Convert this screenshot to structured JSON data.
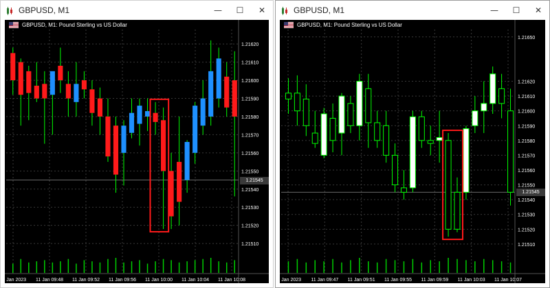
{
  "windows": [
    {
      "title": "GBPUSD, M1",
      "caption": "GBPUSD, M1:  Pound Sterling vs US Dollar",
      "current_price": "1.21545",
      "colors": {
        "bull": "#1e90ff",
        "bear": "#ff1a1a",
        "wick": "#00ff00",
        "highlight": "#ff1a1a"
      },
      "chart_data": {
        "type": "candlestick",
        "style": "colored-bodies",
        "y_axis_labels": [
          "1.21620",
          "1.21610",
          "1.21600",
          "1.21590",
          "1.21580",
          "1.21570",
          "1.21560",
          "1.21550",
          "1.21540",
          "1.21530",
          "1.21520",
          "1.21510"
        ],
        "ylim": [
          1.21504,
          1.21628
        ],
        "x_axis_labels": [
          "11 Jan 2023",
          "11 Jan 09:48",
          "11 Jan 09:52",
          "11 Jan 09:56",
          "11 Jan 10:00",
          "11 Jan 10:04",
          "11 Jan 10:08"
        ],
        "candles": [
          {
            "o": 1.21615,
            "h": 1.21618,
            "l": 1.21592,
            "c": 1.216
          },
          {
            "o": 1.2161,
            "h": 1.21612,
            "l": 1.21575,
            "c": 1.21592
          },
          {
            "o": 1.21605,
            "h": 1.21608,
            "l": 1.21578,
            "c": 1.21593
          },
          {
            "o": 1.21597,
            "h": 1.2161,
            "l": 1.21588,
            "c": 1.2159
          },
          {
            "o": 1.21598,
            "h": 1.21605,
            "l": 1.21565,
            "c": 1.2159
          },
          {
            "o": 1.21592,
            "h": 1.216,
            "l": 1.2157,
            "c": 1.21605
          },
          {
            "o": 1.21608,
            "h": 1.21618,
            "l": 1.21593,
            "c": 1.216
          },
          {
            "o": 1.21598,
            "h": 1.21605,
            "l": 1.2158,
            "c": 1.2159
          },
          {
            "o": 1.21588,
            "h": 1.2161,
            "l": 1.2158,
            "c": 1.21598
          },
          {
            "o": 1.216,
            "h": 1.21605,
            "l": 1.2159,
            "c": 1.21595
          },
          {
            "o": 1.21595,
            "h": 1.216,
            "l": 1.21575,
            "c": 1.21582
          },
          {
            "o": 1.2159,
            "h": 1.21596,
            "l": 1.2157,
            "c": 1.2158
          },
          {
            "o": 1.2158,
            "h": 1.2159,
            "l": 1.21555,
            "c": 1.21558
          },
          {
            "o": 1.21575,
            "h": 1.2158,
            "l": 1.21538,
            "c": 1.21548
          },
          {
            "o": 1.2156,
            "h": 1.21578,
            "l": 1.21542,
            "c": 1.21575
          },
          {
            "o": 1.21571,
            "h": 1.2159,
            "l": 1.21568,
            "c": 1.21582
          },
          {
            "o": 1.21576,
            "h": 1.2159,
            "l": 1.21564,
            "c": 1.21586
          },
          {
            "o": 1.2158,
            "h": 1.2159,
            "l": 1.21572,
            "c": 1.21583
          },
          {
            "o": 1.21582,
            "h": 1.21588,
            "l": 1.2157,
            "c": 1.21577
          },
          {
            "o": 1.21578,
            "h": 1.21585,
            "l": 1.21518,
            "c": 1.2155
          },
          {
            "o": 1.2155,
            "h": 1.2156,
            "l": 1.21518,
            "c": 1.21525
          },
          {
            "o": 1.21555,
            "h": 1.2158,
            "l": 1.2152,
            "c": 1.21533
          },
          {
            "o": 1.21545,
            "h": 1.21567,
            "l": 1.21538,
            "c": 1.21566
          },
          {
            "o": 1.2156,
            "h": 1.21588,
            "l": 1.21554,
            "c": 1.21586
          },
          {
            "o": 1.21575,
            "h": 1.216,
            "l": 1.2157,
            "c": 1.2159
          },
          {
            "o": 1.2158,
            "h": 1.21622,
            "l": 1.21575,
            "c": 1.21605
          },
          {
            "o": 1.2159,
            "h": 1.21618,
            "l": 1.21585,
            "c": 1.21612
          },
          {
            "o": 1.21602,
            "h": 1.2161,
            "l": 1.2158,
            "c": 1.21585
          },
          {
            "o": 1.216,
            "h": 1.21616,
            "l": 1.21536,
            "c": 1.2158
          }
        ],
        "highlight_candles": [
          18,
          19
        ],
        "volume": [
          8,
          12,
          9,
          10,
          11,
          9,
          10,
          12,
          8,
          11,
          10,
          9,
          12,
          13,
          9,
          10,
          11,
          8,
          10,
          12,
          11,
          9,
          10,
          11,
          12,
          13,
          10,
          9,
          11
        ],
        "grid": true
      }
    },
    {
      "title": "GBPUSD, M1",
      "caption": "GBPUSD, M1:  Pound Sterling vs US Dollar",
      "current_price": "1.21545",
      "colors": {
        "bull": "#ffffff",
        "bear": "#000000",
        "wick": "#00ff00",
        "highlight": "#ff1a1a"
      },
      "chart_data": {
        "type": "candlestick",
        "style": "hollow",
        "y_axis_labels": [
          "1.21650",
          "1.21620",
          "1.21610",
          "1.21600",
          "1.21590",
          "1.21580",
          "1.21570",
          "1.21560",
          "1.21550",
          "1.21540",
          "1.21530",
          "1.21520",
          "1.21510"
        ],
        "ylim": [
          1.21503,
          1.21655
        ],
        "x_axis_labels": [
          "11 Jan 2023",
          "11 Jan 09:47",
          "11 Jan 09:51",
          "11 Jan 09:55",
          "11 Jan 09:59",
          "11 Jan 10:03",
          "11 Jan 10:07"
        ],
        "candles": [
          {
            "o": 1.21612,
            "h": 1.21622,
            "l": 1.21598,
            "c": 1.21608
          },
          {
            "o": 1.21612,
            "h": 1.21624,
            "l": 1.2159,
            "c": 1.216
          },
          {
            "o": 1.21608,
            "h": 1.21618,
            "l": 1.21583,
            "c": 1.2159
          },
          {
            "o": 1.21585,
            "h": 1.216,
            "l": 1.21575,
            "c": 1.21578
          },
          {
            "o": 1.2157,
            "h": 1.21602,
            "l": 1.21568,
            "c": 1.21598
          },
          {
            "o": 1.21595,
            "h": 1.21605,
            "l": 1.21572,
            "c": 1.2158
          },
          {
            "o": 1.21585,
            "h": 1.21612,
            "l": 1.2157,
            "c": 1.2161
          },
          {
            "o": 1.21605,
            "h": 1.2161,
            "l": 1.21585,
            "c": 1.2159
          },
          {
            "o": 1.2159,
            "h": 1.21625,
            "l": 1.2158,
            "c": 1.2162
          },
          {
            "o": 1.21615,
            "h": 1.21625,
            "l": 1.21575,
            "c": 1.21592
          },
          {
            "o": 1.21592,
            "h": 1.216,
            "l": 1.21575,
            "c": 1.2158
          },
          {
            "o": 1.2159,
            "h": 1.216,
            "l": 1.21565,
            "c": 1.2157
          },
          {
            "o": 1.2157,
            "h": 1.21578,
            "l": 1.21545,
            "c": 1.2155
          },
          {
            "o": 1.21548,
            "h": 1.2156,
            "l": 1.2154,
            "c": 1.21545
          },
          {
            "o": 1.21548,
            "h": 1.216,
            "l": 1.21545,
            "c": 1.21596
          },
          {
            "o": 1.21596,
            "h": 1.216,
            "l": 1.21575,
            "c": 1.2158
          },
          {
            "o": 1.2158,
            "h": 1.2159,
            "l": 1.2157,
            "c": 1.21578
          },
          {
            "o": 1.2158,
            "h": 1.216,
            "l": 1.21565,
            "c": 1.21582
          },
          {
            "o": 1.2158,
            "h": 1.21585,
            "l": 1.21515,
            "c": 1.2152
          },
          {
            "o": 1.21545,
            "h": 1.21555,
            "l": 1.21518,
            "c": 1.2152
          },
          {
            "o": 1.21545,
            "h": 1.2159,
            "l": 1.2154,
            "c": 1.21588
          },
          {
            "o": 1.2159,
            "h": 1.2161,
            "l": 1.21585,
            "c": 1.216
          },
          {
            "o": 1.216,
            "h": 1.2162,
            "l": 1.21585,
            "c": 1.21605
          },
          {
            "o": 1.21605,
            "h": 1.2163,
            "l": 1.21598,
            "c": 1.21625
          },
          {
            "o": 1.21615,
            "h": 1.21625,
            "l": 1.21595,
            "c": 1.21605
          },
          {
            "o": 1.216,
            "h": 1.21615,
            "l": 1.21536,
            "c": 1.21545
          }
        ],
        "highlight_candles": [
          18,
          19
        ],
        "volume": [
          10,
          12,
          9,
          11,
          10,
          12,
          9,
          11,
          13,
          10,
          9,
          12,
          11,
          10,
          12,
          9,
          11,
          10,
          13,
          12,
          11,
          10,
          12,
          11,
          10,
          9
        ],
        "grid": true
      }
    }
  ]
}
